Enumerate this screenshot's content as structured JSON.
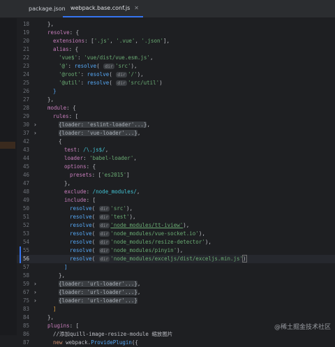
{
  "tabs": [
    {
      "label": "package.json",
      "active": false,
      "icon": "json-file-icon"
    },
    {
      "label": "webpack.base.conf.js",
      "active": true,
      "icon": "js-file-icon"
    }
  ],
  "lines": [
    {
      "n": "18",
      "t": "},"
    },
    {
      "n": "19",
      "t": "resolve: {"
    },
    {
      "n": "20",
      "t": "extensions: ['.js', '.vue', '.json'],"
    },
    {
      "n": "21",
      "t": "alias: {"
    },
    {
      "n": "22",
      "t": "'vue$': 'vue/dist/vue.esm.js',"
    },
    {
      "n": "23",
      "t": "'@': resolve( dir 'src'),"
    },
    {
      "n": "24",
      "t": "'@root': resolve( dir '/'),"
    },
    {
      "n": "25",
      "t": "'@util': resolve( dir 'src/util')"
    },
    {
      "n": "26",
      "t": "}"
    },
    {
      "n": "27",
      "t": "},"
    },
    {
      "n": "28",
      "t": "module: {"
    },
    {
      "n": "29",
      "t": "rules: ["
    },
    {
      "n": "30",
      "t": "{loader: 'eslint-loader'...},"
    },
    {
      "n": "37",
      "t": "{loader: 'vue-loader'...},"
    },
    {
      "n": "42",
      "t": "{"
    },
    {
      "n": "43",
      "t": "test: /\\.js$/,"
    },
    {
      "n": "44",
      "t": "loader: 'babel-loader',"
    },
    {
      "n": "45",
      "t": "options: {"
    },
    {
      "n": "46",
      "t": "presets: ['es2015']"
    },
    {
      "n": "47",
      "t": "},"
    },
    {
      "n": "48",
      "t": "exclude: /node_modules/,"
    },
    {
      "n": "49",
      "t": "include: ["
    },
    {
      "n": "50",
      "t": "resolve( dir 'src'),"
    },
    {
      "n": "51",
      "t": "resolve( dir 'test'),"
    },
    {
      "n": "52",
      "t": "resolve( dir 'node_modules/tt-iview'),"
    },
    {
      "n": "53",
      "t": "resolve( dir 'node_modules/vue-socket.io'),"
    },
    {
      "n": "54",
      "t": "resolve( dir 'node_modules/resize-detector'),"
    },
    {
      "n": "55",
      "t": "resolve( dir 'node_modules/pinyin'),"
    },
    {
      "n": "56",
      "t": "resolve( dir 'node_modules/exceljs/dist/exceljs.min.js')"
    },
    {
      "n": "57",
      "t": "]"
    },
    {
      "n": "58",
      "t": "},"
    },
    {
      "n": "59",
      "t": "{loader: 'url-loader'...},"
    },
    {
      "n": "67",
      "t": "{loader: 'url-loader'...},"
    },
    {
      "n": "75",
      "t": "{loader: 'url-loader'...}"
    },
    {
      "n": "83",
      "t": "]"
    },
    {
      "n": "84",
      "t": "},"
    },
    {
      "n": "85",
      "t": "plugins: ["
    },
    {
      "n": "86",
      "t": "//添加quill-image-resize-module 缩放图片"
    },
    {
      "n": "87",
      "t": "new webpack.ProvidePlugin({"
    }
  ],
  "code": {
    "l19_key": "resolve",
    "l20_key": "extensions",
    "l20_vals": [
      "'.js'",
      "'.vue'",
      "'.json'"
    ],
    "l21_key": "alias",
    "l22_key": "'vue$'",
    "l22_val": "'vue/dist/vue.esm.js'",
    "l23_key": "'@'",
    "l23_arg": "'src'",
    "l24_key": "'@root'",
    "l24_arg": "'/'",
    "l25_key": "'@util'",
    "l25_arg": "'src/util'",
    "l28_key": "module",
    "l29_key": "rules",
    "l30_fold": "{loader: 'eslint-loader'...}",
    "l37_fold": "{loader: 'vue-loader'...}",
    "l43_key": "test",
    "l43_val": "/\\.js$/",
    "l44_key": "loader",
    "l44_val": "'babel-loader'",
    "l45_key": "options",
    "l46_key": "presets",
    "l46_val": "'es2015'",
    "l48_key": "exclude",
    "l48_val": "/node_modules/",
    "l49_key": "include",
    "inc": [
      "'src'",
      "'test'",
      "'node_modules/tt-iview'",
      "'node_modules/vue-socket.io'",
      "'node_modules/resize-detector'",
      "'node_modules/pinyin'",
      "'node_modules/exceljs/dist/exceljs.min.js'"
    ],
    "url_fold": "{loader: 'url-loader'...}",
    "l85_key": "plugins",
    "l86_comment": "//添加quill-image-resize-module 缩放图片",
    "l87_new": "new",
    "l87_obj": "webpack",
    "l87_fn": "ProvidePlugin",
    "fn_resolve": "resolve",
    "hint": "dir"
  },
  "watermark": "@稀土掘金技术社区"
}
